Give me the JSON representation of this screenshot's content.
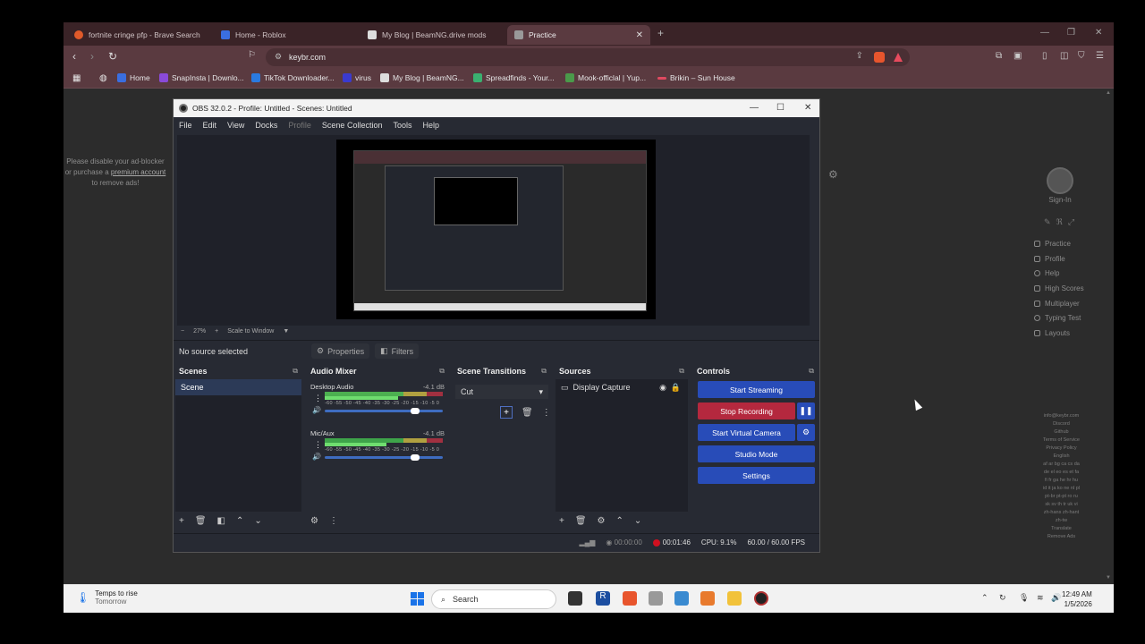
{
  "browser": {
    "tabs": [
      {
        "title": "fortnite cringe pfp - Brave Search",
        "icon": "brave-search-icon",
        "color": "#e05a2a"
      },
      {
        "title": "Home - Roblox",
        "icon": "roblox-icon",
        "color": "#3a6ee0"
      },
      {
        "title": "My Blog | BeamNG.drive mods",
        "icon": "wix-icon",
        "color": "#dddddd"
      },
      {
        "title": "Practice",
        "icon": "keybr-icon",
        "color": "#999999"
      }
    ],
    "url": "keybr.com",
    "bookmarks": [
      {
        "label": "Home",
        "icon": "roblox-icon"
      },
      {
        "label": "SnapInsta | Downlo...",
        "icon": "snapinsta-icon"
      },
      {
        "label": "TikTok Downloader...",
        "icon": "tiktok-icon"
      },
      {
        "label": "virus",
        "icon": "folder-icon"
      },
      {
        "label": "My Blog | BeamNG...",
        "icon": "wix-icon"
      },
      {
        "label": "Spreadfinds - Your...",
        "icon": "spreadfinds-icon"
      },
      {
        "label": "Mook-officlal | Yup...",
        "icon": "yupoo-icon"
      },
      {
        "label": "Brikin – Sun House",
        "icon": "brikin-icon"
      }
    ]
  },
  "page": {
    "ad_note_1": "Please disable your ad-blocker or purchase a",
    "ad_note_link": "premium account",
    "ad_note_2": "to remove ads!",
    "signin": "Sign-In",
    "menu": [
      "Practice",
      "Profile",
      "Help",
      "High Scores",
      "Multiplayer",
      "Typing Test",
      "Layouts"
    ],
    "footer": [
      "info@keybr.com",
      "Discord",
      "Github",
      "Terms of Service",
      "Privacy Policy",
      "English",
      "af ar bg ca cs da",
      "de el eo es et fa",
      "fi fr ga he hr hu",
      "id it ja ko ne nl pl",
      "pt-br pt-pt ro ru",
      "sk sv th tr uk vi",
      "zh-hans zh-hant",
      "zh-tw",
      "Translate",
      "Remove Ads"
    ]
  },
  "obs": {
    "title": "OBS 32.0.2 - Profile: Untitled - Scenes: Untitled",
    "menu": [
      "File",
      "Edit",
      "View",
      "Docks",
      "Profile",
      "Scene Collection",
      "Tools",
      "Help"
    ],
    "zoom": "27%",
    "scale_mode": "Scale to Window",
    "no_source": "No source selected",
    "properties": "Properties",
    "filters": "Filters",
    "docks": {
      "scenes": "Scenes",
      "audio_mixer": "Audio Mixer",
      "transitions": "Scene Transitions",
      "sources": "Sources",
      "controls": "Controls"
    },
    "scene_item": "Scene",
    "audio": [
      {
        "name": "Desktop Audio",
        "db": "-4.1 dB",
        "level": 0.62
      },
      {
        "name": "Mic/Aux",
        "db": "-4.1 dB",
        "level": 0.52
      }
    ],
    "meter_ticks": "-60 -55 -50 -45 -40 -35 -30 -25 -20 -15 -10 -5  0",
    "transition": "Cut",
    "source_item": "Display Capture",
    "controls": {
      "start_streaming": "Start Streaming",
      "stop_recording": "Stop Recording",
      "start_virtual_camera": "Start Virtual Camera",
      "studio_mode": "Studio Mode",
      "settings": "Settings"
    },
    "status": {
      "stream_time": "00:00:00",
      "rec_time": "00:01:46",
      "cpu": "CPU: 9.1%",
      "fps": "60.00 / 60.00 FPS"
    }
  },
  "taskbar": {
    "weather_title": "Temps to rise",
    "weather_sub": "Tomorrow",
    "search": "Search",
    "time": "12:49 AM",
    "date": "1/5/2026"
  }
}
